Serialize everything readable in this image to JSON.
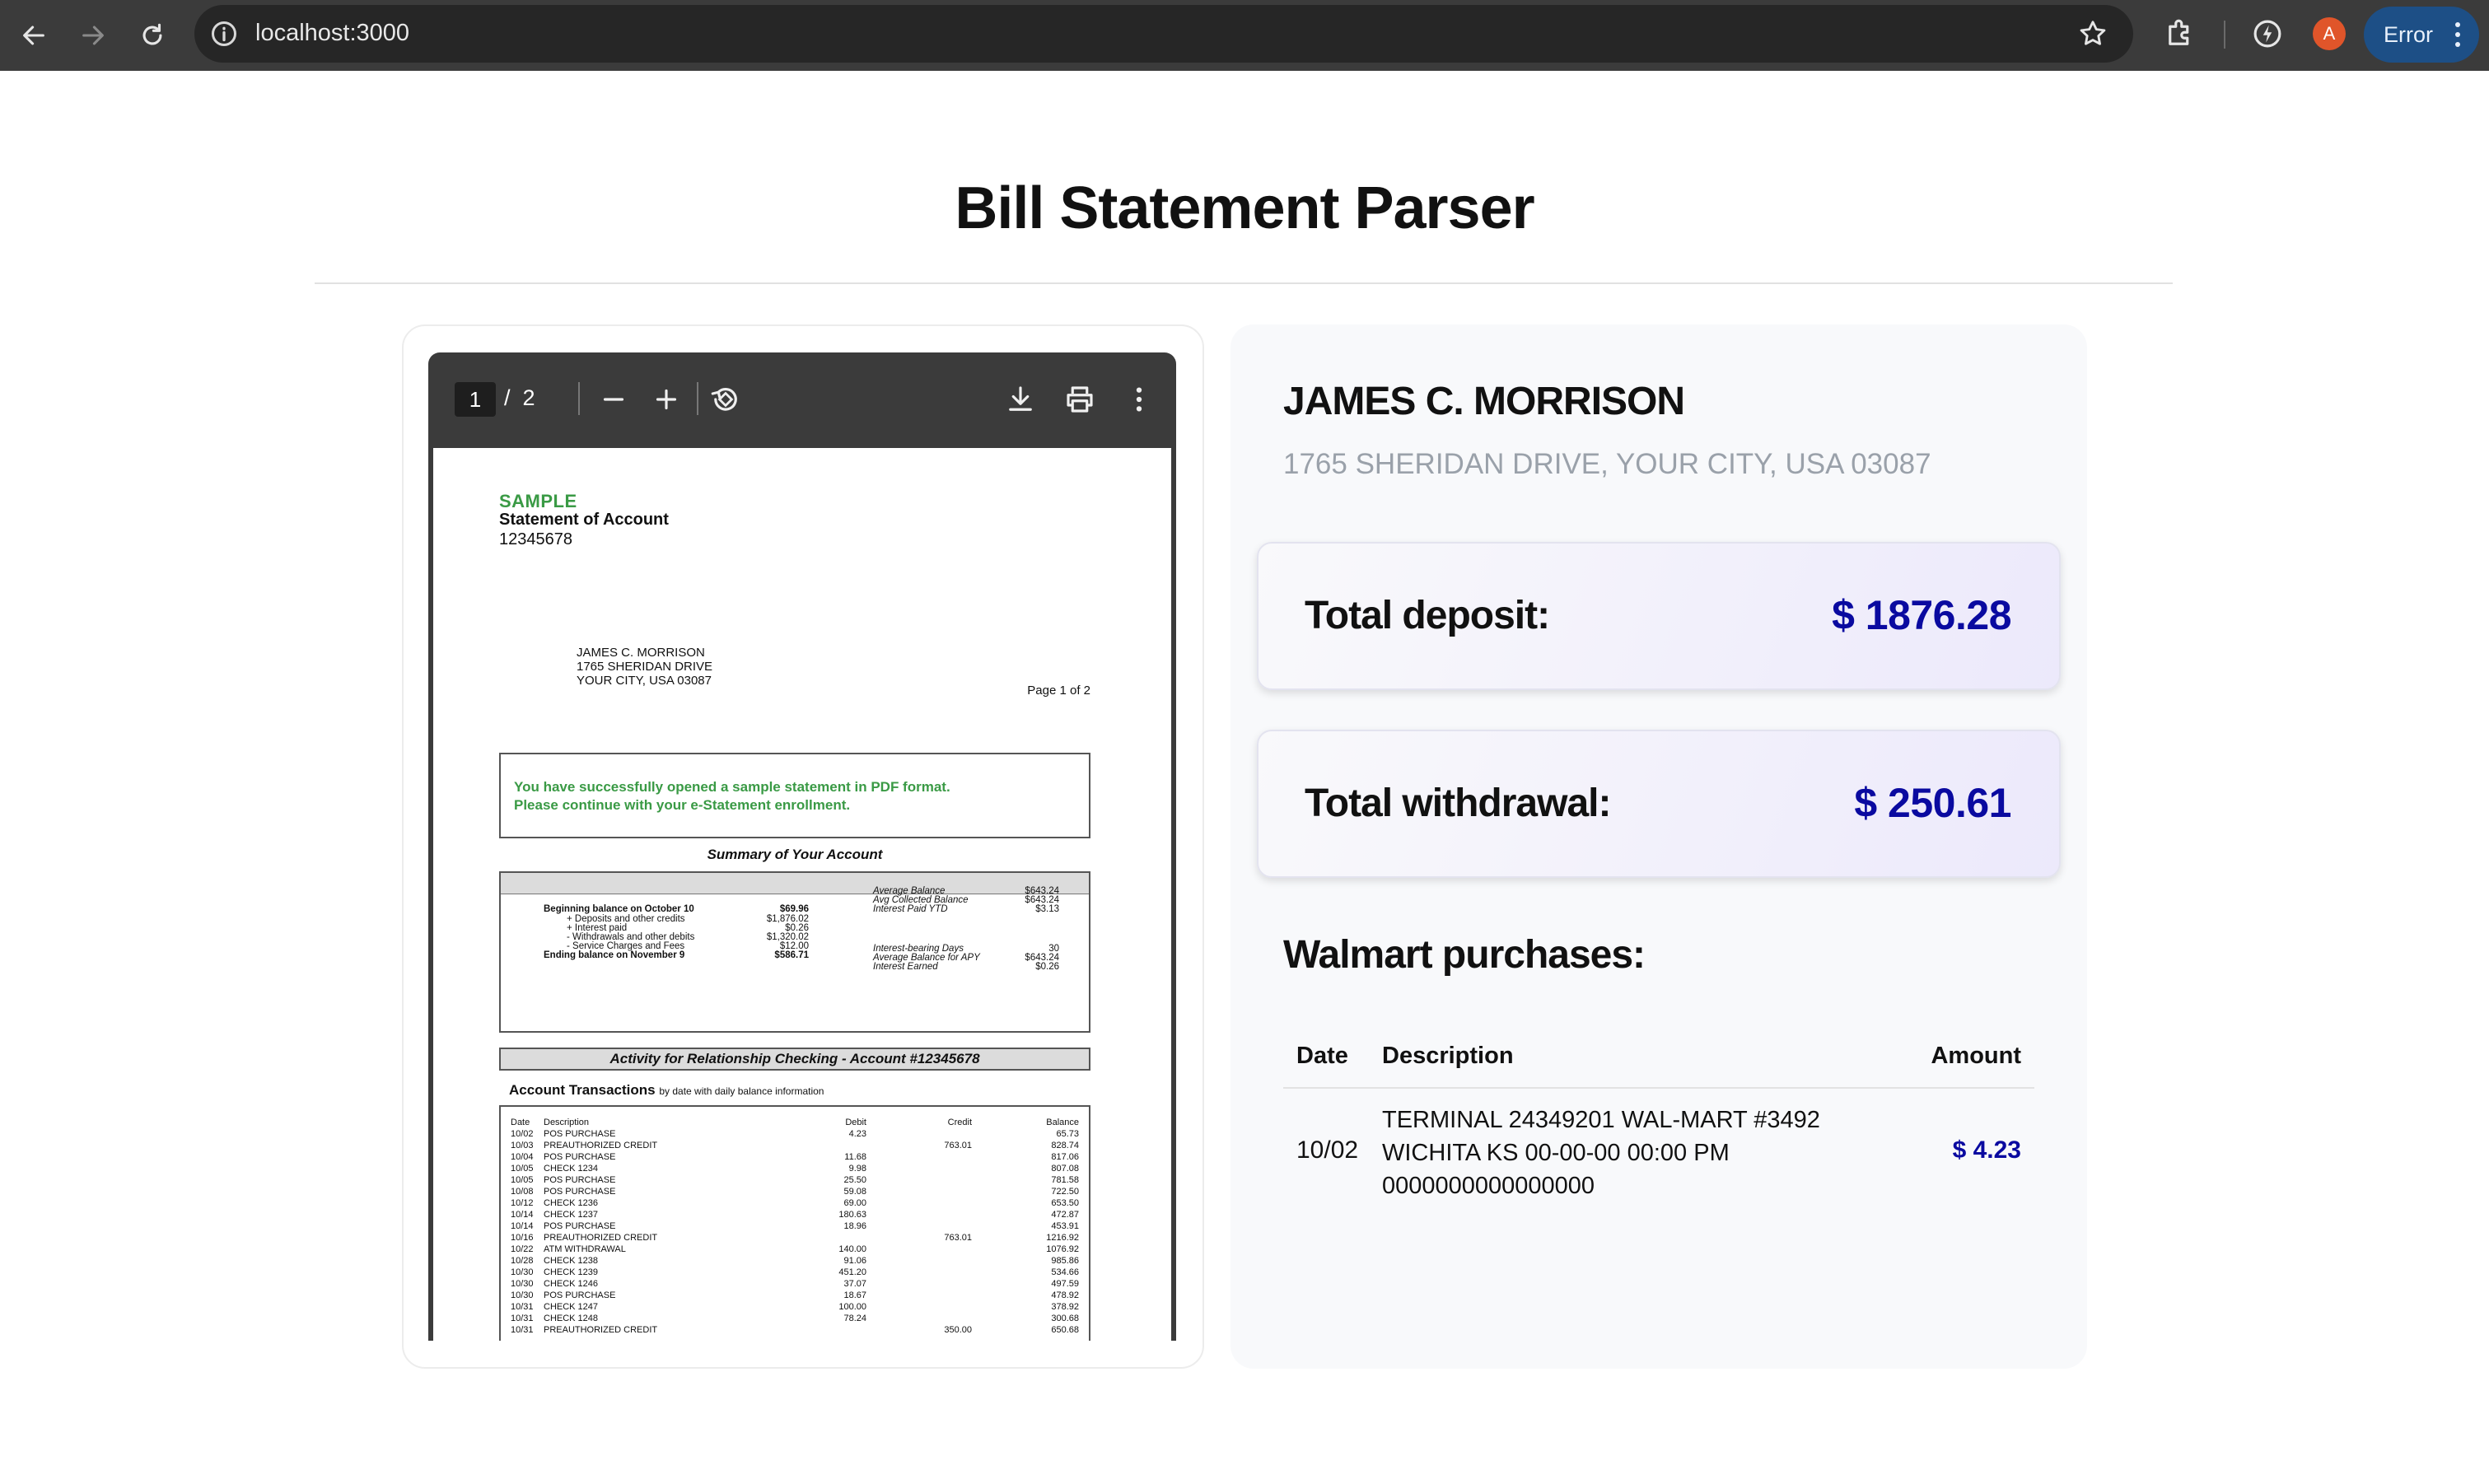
{
  "browser": {
    "url": "localhost:3000",
    "profile_initial": "A",
    "error_label": "Error"
  },
  "page": {
    "title": "Bill Statement Parser"
  },
  "pdf_viewer": {
    "current_page": "1",
    "separator": "/",
    "total_pages": "2",
    "document": {
      "sample": "SAMPLE",
      "title": "Statement of Account",
      "account_number": "12345678",
      "address_lines": [
        "JAMES C. MORRISON",
        "1765 SHERIDAN DRIVE",
        "YOUR CITY, USA 03087"
      ],
      "page_label": "Page 1 of 2",
      "notice_line1": "You have successfully opened a sample statement in PDF format.",
      "notice_line2": "Please continue with your e-Statement enrollment.",
      "summary_title": "Summary of Your Account",
      "summary_left": [
        {
          "label": "Beginning balance on October 10",
          "value": "$69.96",
          "bold": true
        },
        {
          "label": "+ Deposits and other credits",
          "value": "$1,876.02",
          "bold": false
        },
        {
          "label": "+ Interest paid",
          "value": "$0.26",
          "bold": false
        },
        {
          "label": "- Withdrawals and other debits",
          "value": "$1,320.02",
          "bold": false
        },
        {
          "label": "- Service Charges and Fees",
          "value": "$12.00",
          "bold": false
        },
        {
          "label": "Ending balance on November 9",
          "value": "$586.71",
          "bold": true
        }
      ],
      "summary_right": [
        {
          "label": "Average Balance",
          "value": "$643.24"
        },
        {
          "label": "Avg Collected Balance",
          "value": "$643.24"
        },
        {
          "label": "Interest Paid YTD",
          "value": "$3.13"
        },
        {
          "label": "Interest-bearing Days",
          "value": "30"
        },
        {
          "label": "Average Balance for APY",
          "value": "$643.24"
        },
        {
          "label": "Interest Earned",
          "value": "$0.26"
        }
      ],
      "activity_title": "Activity for Relationship Checking - Account #12345678",
      "transactions_title": "Account Transactions",
      "transactions_subtitle": "by date with daily balance information",
      "tx_headers": {
        "date": "Date",
        "description": "Description",
        "debit": "Debit",
        "credit": "Credit",
        "balance": "Balance"
      },
      "transactions": [
        {
          "date": "10/02",
          "desc": "POS PURCHASE",
          "debit": "4.23",
          "credit": "",
          "balance": "65.73"
        },
        {
          "date": "10/03",
          "desc": "PREAUTHORIZED CREDIT",
          "debit": "",
          "credit": "763.01",
          "balance": "828.74"
        },
        {
          "date": "10/04",
          "desc": "POS PURCHASE",
          "debit": "11.68",
          "credit": "",
          "balance": "817.06"
        },
        {
          "date": "10/05",
          "desc": "CHECK 1234",
          "debit": "9.98",
          "credit": "",
          "balance": "807.08"
        },
        {
          "date": "10/05",
          "desc": "POS PURCHASE",
          "debit": "25.50",
          "credit": "",
          "balance": "781.58"
        },
        {
          "date": "10/08",
          "desc": "POS PURCHASE",
          "debit": "59.08",
          "credit": "",
          "balance": "722.50"
        },
        {
          "date": "10/12",
          "desc": "CHECK 1236",
          "debit": "69.00",
          "credit": "",
          "balance": "653.50"
        },
        {
          "date": "10/14",
          "desc": "CHECK 1237",
          "debit": "180.63",
          "credit": "",
          "balance": "472.87"
        },
        {
          "date": "10/14",
          "desc": "POS PURCHASE",
          "debit": "18.96",
          "credit": "",
          "balance": "453.91"
        },
        {
          "date": "10/16",
          "desc": "PREAUTHORIZED CREDIT",
          "debit": "",
          "credit": "763.01",
          "balance": "1216.92"
        },
        {
          "date": "10/22",
          "desc": "ATM WITHDRAWAL",
          "debit": "140.00",
          "credit": "",
          "balance": "1076.92"
        },
        {
          "date": "10/28",
          "desc": "CHECK 1238",
          "debit": "91.06",
          "credit": "",
          "balance": "985.86"
        },
        {
          "date": "10/30",
          "desc": "CHECK 1239",
          "debit": "451.20",
          "credit": "",
          "balance": "534.66"
        },
        {
          "date": "10/30",
          "desc": "CHECK 1246",
          "debit": "37.07",
          "credit": "",
          "balance": "497.59"
        },
        {
          "date": "10/30",
          "desc": "POS PURCHASE",
          "debit": "18.67",
          "credit": "",
          "balance": "478.92"
        },
        {
          "date": "10/31",
          "desc": "CHECK 1247",
          "debit": "100.00",
          "credit": "",
          "balance": "378.92"
        },
        {
          "date": "10/31",
          "desc": "CHECK 1248",
          "debit": "78.24",
          "credit": "",
          "balance": "300.68"
        },
        {
          "date": "10/31",
          "desc": "PREAUTHORIZED CREDIT",
          "debit": "",
          "credit": "350.00",
          "balance": "650.68"
        }
      ]
    }
  },
  "customer": {
    "name": "JAMES C. MORRISON",
    "address": "1765 SHERIDAN DRIVE, YOUR CITY, USA 03087"
  },
  "totals": {
    "deposit_label": "Total deposit:",
    "deposit_value": "$ 1876.28",
    "withdrawal_label": "Total withdrawal:",
    "withdrawal_value": "$ 250.61"
  },
  "walmart": {
    "title": "Walmart purchases:",
    "headers": {
      "date": "Date",
      "description": "Description",
      "amount": "Amount"
    },
    "rows": [
      {
        "date": "10/02",
        "description": "TERMINAL 24349201 WAL-MART #3492 WICHITA KS 00-00-00 00:00 PM 0000000000000000",
        "amount": "$ 4.23"
      }
    ]
  },
  "colors": {
    "accent_blue": "#0a0aa0",
    "sample_green": "#3a9a45",
    "error_pill": "#1d4f86",
    "avatar": "#e0552a"
  }
}
